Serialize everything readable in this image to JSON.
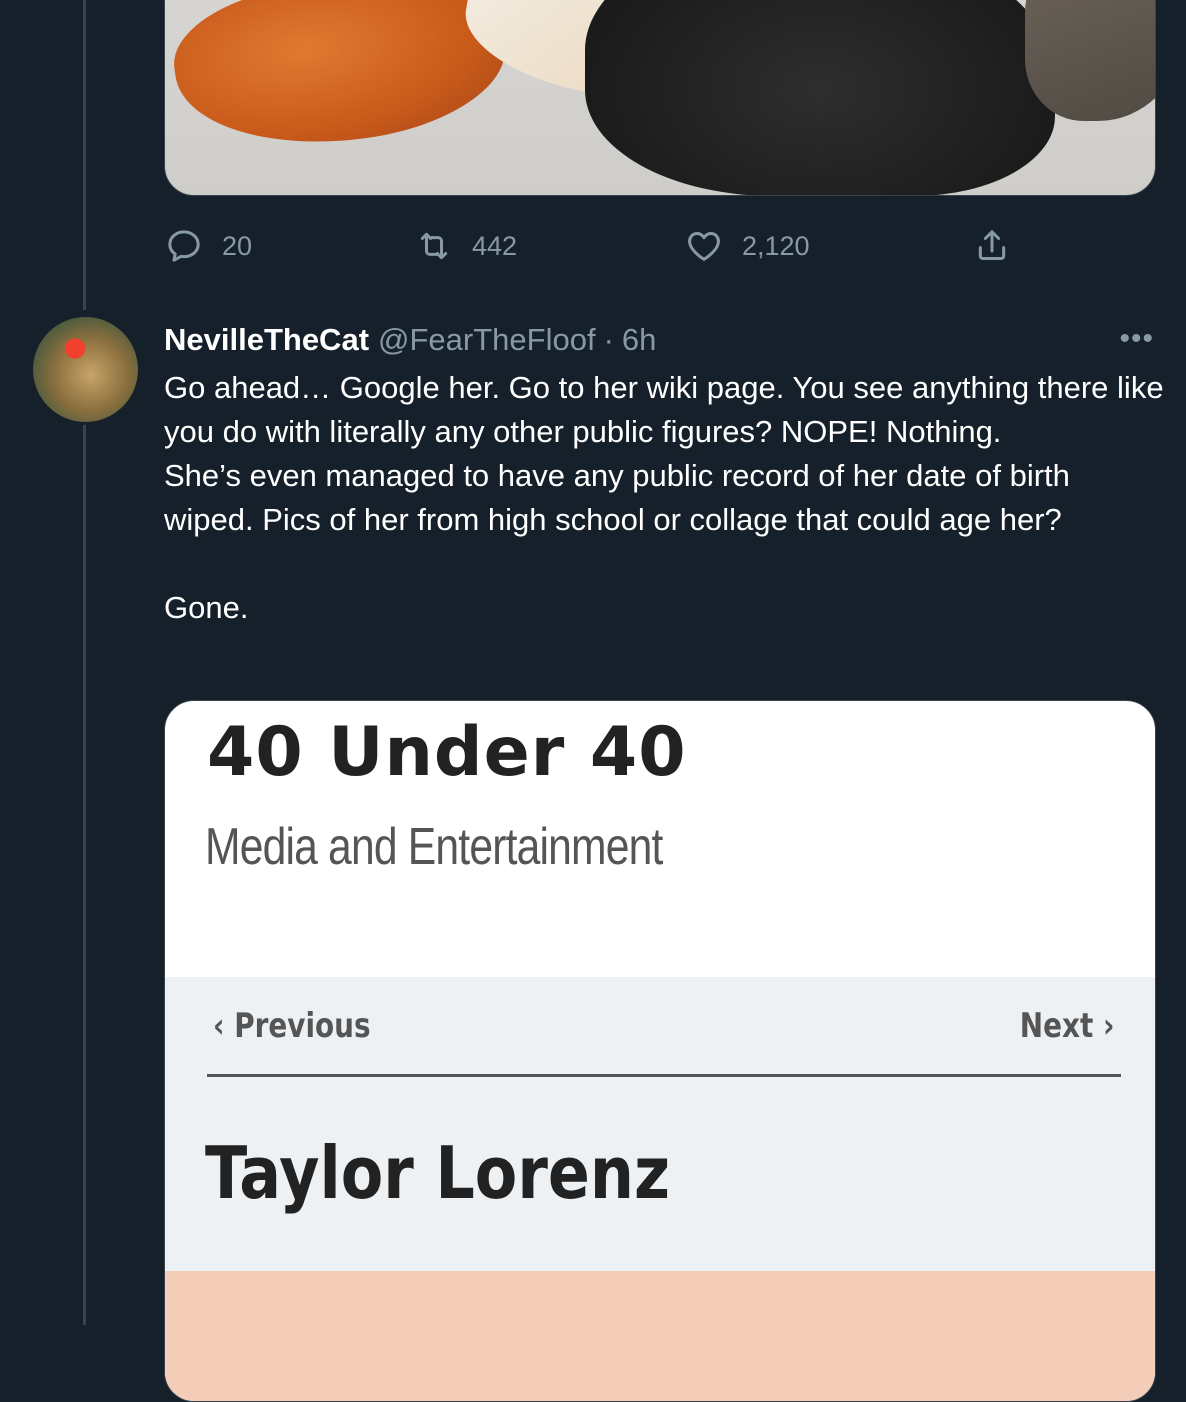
{
  "first_tweet": {
    "actions": {
      "reply_count": "20",
      "retweet_count": "442",
      "like_count": "2,120"
    }
  },
  "reply_tweet": {
    "display_name": "NevilleTheCat",
    "handle": "@FearTheFloof",
    "separator": "·",
    "time": "6h",
    "more": "•••",
    "text": "Go ahead… Google her. Go to her wiki page. You see anything there like you do with literally any other public figures? NOPE! Nothing.\nShe’s even managed to have any public record of her date of birth wiped. Pics of her from high school or collage that could age her?\n\nGone.",
    "media": {
      "title": "40 Under 40",
      "subtitle": "Media and Entertainment",
      "previous": "‹ Previous",
      "next": "Next ›",
      "name": "Taylor Lorenz"
    }
  },
  "colors": {
    "background": "#15202b",
    "muted": "#8899a6",
    "border": "#38444d"
  }
}
